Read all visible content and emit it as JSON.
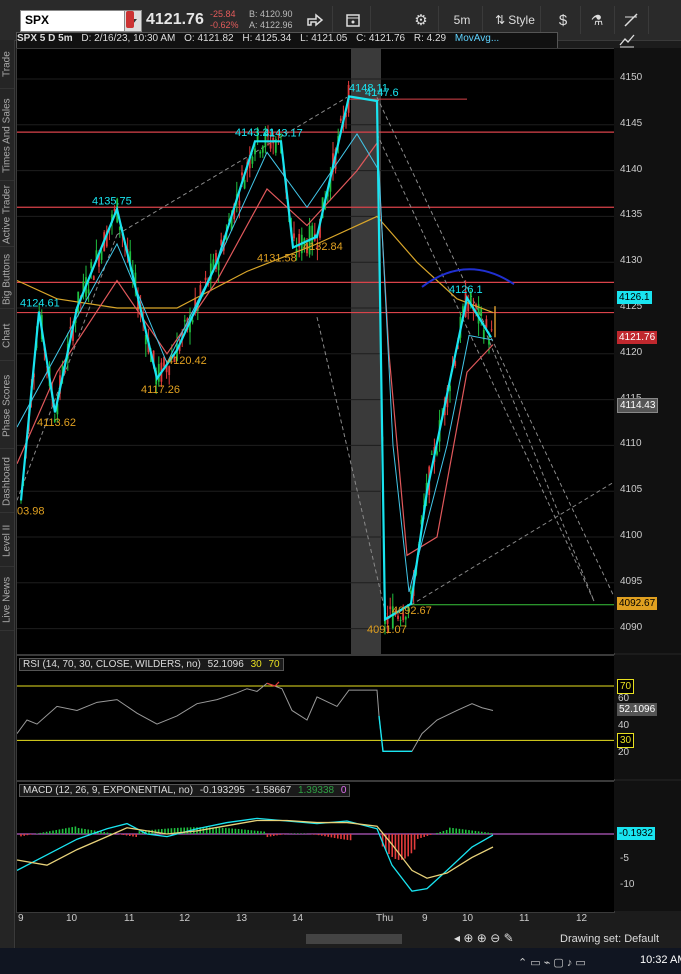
{
  "toolbar": {
    "symbol": "SPX",
    "last_price": "4121.76",
    "change": "-25.84",
    "change_pct": "-0.62%",
    "bid": "B: 4120.90",
    "ask": "A: 4122.96",
    "timeframe": "5m",
    "style_label": "Style",
    "icons": [
      "share-icon",
      "calendar-icon",
      "gear-icon",
      "timeframe-dropdown",
      "style-dropdown",
      "dollar-icon",
      "flask-icon",
      "drawing-icon"
    ]
  },
  "side_tabs": [
    "Trade",
    "Times And Sales",
    "Active Trader",
    "Big Buttons",
    "Chart",
    "Phase Scores",
    "Dashboard",
    "Level II",
    "Live News"
  ],
  "chart_header": {
    "title": "SPX 5 D 5m",
    "date": "D: 2/16/23, 10:30 AM",
    "open": "O: 4121.82",
    "high": "H: 4125.34",
    "low": "L: 4121.05",
    "close": "C: 4121.76",
    "range": "R: 4.29",
    "study": "MovAvg..."
  },
  "price_pane": {
    "axis_ticks": [
      "4150",
      "4145",
      "4140",
      "4135",
      "4130",
      "4125",
      "4120",
      "4115",
      "4110",
      "4105",
      "4100",
      "4095",
      "4090"
    ],
    "badges": {
      "level1": "4126.1",
      "last": "4121.76",
      "level2": "4114.43",
      "level3": "4092.67"
    },
    "annotations": [
      "4148.11",
      "4147.6",
      "4143.21",
      "4143.17",
      "4135.75",
      "4132.84",
      "4131.58",
      "4124.61",
      "4126.1",
      "4120.42",
      "4117.26",
      "4113.62",
      "4092.67",
      "4091.07",
      "03.98"
    ],
    "colors": {
      "zigzag": "#19e4f0",
      "up": "#1fbf3f",
      "down": "#e23b3b",
      "resistance": "#d9434a",
      "ma_orange": "#d9a62a",
      "ma_red": "#e0585b",
      "support": "#39c43b"
    }
  },
  "rsi_pane": {
    "header": "RSI (14, 70, 30, CLOSE, WILDERS, no)",
    "value": "52.1096",
    "ob": "30",
    "os": "70",
    "ticks": [
      "60",
      "40",
      "20"
    ],
    "badge_70": "70",
    "badge_30": "30"
  },
  "macd_pane": {
    "header": "MACD (12, 26, 9, EXPONENTIAL, no)",
    "value": "-0.193295",
    "avg": "-1.58667",
    "diff": "1.39338",
    "zero": "0",
    "ticks": [
      "0",
      "-5",
      "-10"
    ],
    "badge": "-0.1932"
  },
  "x_axis": [
    "9",
    "10",
    "11",
    "12",
    "13",
    "14",
    "Thu",
    "9",
    "10",
    "11",
    "12"
  ],
  "bottom": {
    "drawing_set": "Drawing set: Default",
    "icons": [
      "scroll-left-icon",
      "zoom-in-icon",
      "zoom-out-icon",
      "crosshair-icon",
      "drawing-icon"
    ]
  },
  "taskbar": {
    "time": "10:32 AM"
  }
}
